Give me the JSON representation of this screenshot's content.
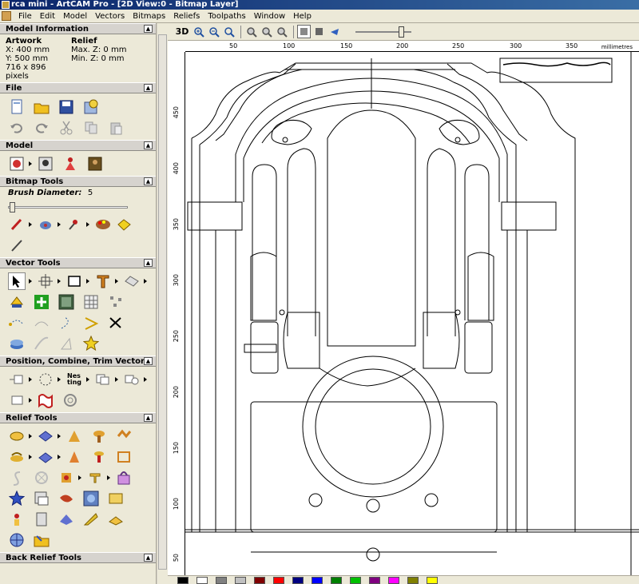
{
  "window": {
    "title": "rca mini - ArtCAM Pro - [2D View:0 - Bitmap Layer]"
  },
  "menu": [
    "File",
    "Edit",
    "Model",
    "Vectors",
    "Bitmaps",
    "Reliefs",
    "Toolpaths",
    "Window",
    "Help"
  ],
  "model_info": {
    "header": "Model Information",
    "artwork_head": "Artwork",
    "artwork_x": "X: 400 mm",
    "artwork_y": "Y: 500 mm",
    "artwork_px": "716 x 896 pixels",
    "relief_head": "Relief",
    "relief_max": "Max. Z: 0 mm",
    "relief_min": "Min. Z: 0 mm"
  },
  "sections": {
    "file": "File",
    "model": "Model",
    "bitmap": "Bitmap Tools",
    "vector": "Vector Tools",
    "position": "Position, Combine, Trim Vectors",
    "relief": "Relief Tools",
    "back_relief": "Back Relief Tools"
  },
  "bitmap_tools": {
    "brush_label": "Brush Diameter:",
    "brush_value": "5"
  },
  "toolbar": {
    "label_3d": "3D"
  },
  "ruler": {
    "top_ticks": [
      "50",
      "100",
      "150",
      "200",
      "250",
      "300",
      "350"
    ],
    "left_ticks": [
      "450",
      "400",
      "350",
      "300",
      "250",
      "200",
      "150",
      "100",
      "50"
    ],
    "units": "millimetres"
  },
  "palette": [
    "#000000",
    "#ffffff",
    "#808080",
    "#c0c0c0",
    "#800000",
    "#ff0000",
    "#000080",
    "#0000ff",
    "#008000",
    "#00c000",
    "#800080",
    "#ff00ff",
    "#808000",
    "#ffff00"
  ],
  "icons": {
    "file_row1": [
      "new-file-icon",
      "open-folder-icon",
      "save-disk-icon",
      "setup-icon"
    ],
    "file_row2": [
      "undo-icon",
      "redo-icon",
      "cut-icon",
      "copy-icon",
      "paste-icon"
    ]
  }
}
